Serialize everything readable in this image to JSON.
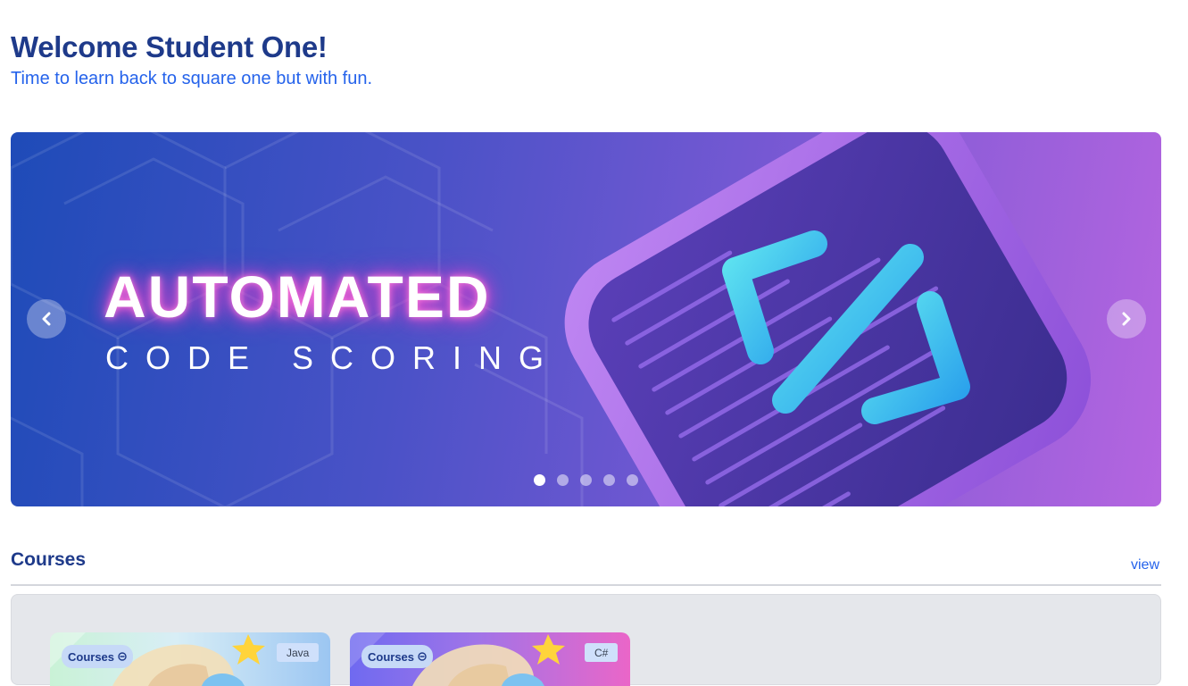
{
  "header": {
    "title": "Welcome Student One!",
    "subtitle": "Time to learn back to square one but with fun."
  },
  "carousel": {
    "headline": "AUTOMATED",
    "subheadline": "CODE SCORING",
    "prev_icon": "chevron-left-icon",
    "next_icon": "chevron-right-icon",
    "slide_count": 5,
    "active_slide": 1
  },
  "courses": {
    "title": "Courses",
    "view_label": "view",
    "cards": [
      {
        "badge": "Courses",
        "language": "Java"
      },
      {
        "badge": "Courses",
        "language": "C#"
      }
    ]
  },
  "colors": {
    "heading": "#1e3a8a",
    "link": "#2563eb",
    "panel": "#e5e7eb"
  }
}
